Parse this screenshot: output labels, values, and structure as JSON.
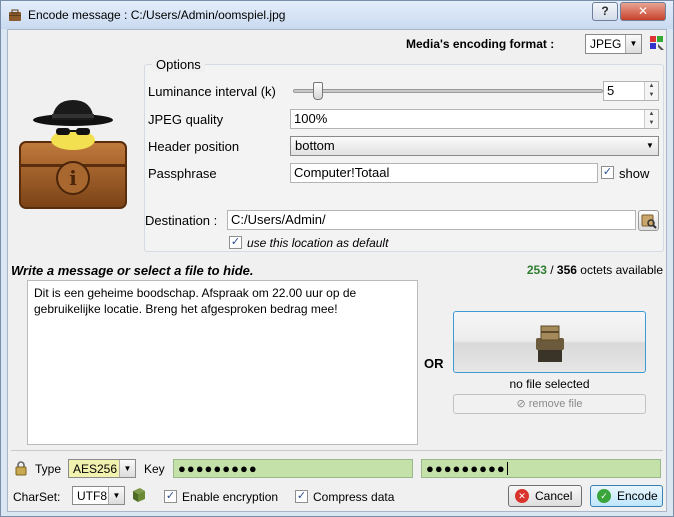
{
  "window": {
    "title": "Encode message : C:/Users/Admin/oomspiel.jpg",
    "help_label": "?",
    "close_label": "✕"
  },
  "format": {
    "label": "Media's encoding format :",
    "value": "JPEG"
  },
  "options": {
    "title": "Options",
    "luminance_label": "Luminance interval (k)",
    "luminance_value": "5",
    "luminance_slider_level": 0.1,
    "jpeg_quality_label": "JPEG quality",
    "jpeg_quality_value": "100%",
    "header_position_label": "Header position",
    "header_position_value": "bottom",
    "passphrase_label": "Passphrase",
    "passphrase_value": "Computer!Totaal",
    "show_label": "show",
    "show_checked": true,
    "destination_label": "Destination :",
    "destination_value": "C:/Users/Admin/",
    "default_location_label": "use this location as default",
    "default_location_checked": true
  },
  "message": {
    "prompt": "Write a message or select a file to hide.",
    "octets_used": "253",
    "octets_separator": " / ",
    "octets_total": "356",
    "octets_suffix": " octets available",
    "text": "Dit is een geheime boodschap. Afspraak om 22.00 uur op de gebruikelijke locatie. Breng het afgesproken bedrag mee!"
  },
  "file": {
    "or_label": "OR",
    "status": "no file selected",
    "remove_label": "remove file"
  },
  "encryption": {
    "type_label": "Type",
    "type_value": "AES256",
    "key_label": "Key",
    "key_value": "●●●●●●●●●",
    "key_confirm_value": "●●●●●●●●●",
    "charset_label": "CharSet:",
    "charset_value": "UTF8",
    "enable_label": "Enable encryption",
    "enable_checked": true,
    "compress_label": "Compress data",
    "compress_checked": true
  },
  "buttons": {
    "cancel_label": "Cancel",
    "encode_label": "Encode"
  },
  "colors": {
    "octets_available": "#2e7d32",
    "key_field_bg": "#c3e1a9",
    "cipher_select_bg": "#f2f2b0",
    "close_button": "#c7412b"
  },
  "icons": {
    "app": "briefcase-icon",
    "format_settings": "color-palette-icon",
    "logo": "spy-hat-briefcase-icon",
    "browse": "folder-search-icon",
    "file": "box-stack-icon",
    "remove": "remove-icon",
    "lock": "lock-icon",
    "charset": "book-icon",
    "cancel": "cancel-icon",
    "encode": "check-icon"
  }
}
